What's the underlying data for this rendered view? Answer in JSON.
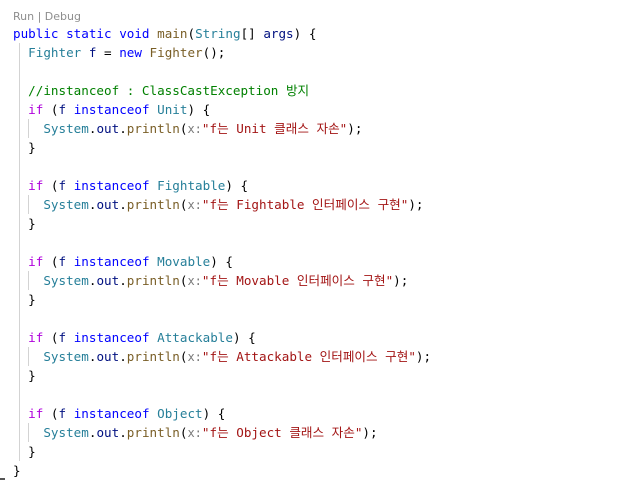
{
  "codelens": {
    "run": "Run",
    "separator": " | ",
    "debug": "Debug"
  },
  "code": {
    "line1": {
      "public": "public",
      "static": "static",
      "void": "void",
      "main": "main",
      "open": "(",
      "type": "String",
      "arr": "[] ",
      "args": "args",
      "close": ") {"
    },
    "line2": {
      "type": "Fighter",
      "var": "f",
      "eq": " = ",
      "new": "new",
      "ctor": "Fighter",
      "end": "();"
    },
    "comment": "//instanceof : ClassCastException 방지",
    "blocks": [
      {
        "if": "if",
        "open": " (",
        "var": "f",
        "instanceof": "instanceof",
        "type": "Unit",
        "close": ") {",
        "system": "System",
        "out": "out",
        "println": "println",
        "hint": "x:",
        "string": "\"f는 Unit 클래스 자손\"",
        "end": ");",
        "brace": "}"
      },
      {
        "if": "if",
        "open": " (",
        "var": "f",
        "instanceof": "instanceof",
        "type": "Fightable",
        "close": ") {",
        "system": "System",
        "out": "out",
        "println": "println",
        "hint": "x:",
        "string": "\"f는 Fightable 인터페이스 구현\"",
        "end": ");",
        "brace": "}"
      },
      {
        "if": "if",
        "open": " (",
        "var": "f",
        "instanceof": "instanceof",
        "type": "Movable",
        "close": ") {",
        "system": "System",
        "out": "out",
        "println": "println",
        "hint": "x:",
        "string": "\"f는 Movable 인터페이스 구현\"",
        "end": ");",
        "brace": "}"
      },
      {
        "if": "if",
        "open": " (",
        "var": "f",
        "instanceof": "instanceof",
        "type": "Attackable",
        "close": ") {",
        "system": "System",
        "out": "out",
        "println": "println",
        "hint": "x:",
        "string": "\"f는 Attackable 인터페이스 구현\"",
        "end": ");",
        "brace": "}"
      },
      {
        "if": "if",
        "open": " (",
        "var": "f",
        "instanceof": "instanceof",
        "type": "Object",
        "close": ") {",
        "system": "System",
        "out": "out",
        "println": "println",
        "hint": "x:",
        "string": "\"f는 Object 클래스 자손\"",
        "end": ");",
        "brace": "}"
      }
    ],
    "closing_brace": "}",
    "colors": {
      "keyword": "#0000ff",
      "type": "#267f99",
      "function": "#795e26",
      "variable": "#001080",
      "string": "#a31515",
      "comment": "#008000",
      "codelens": "#8e8e8e"
    }
  }
}
